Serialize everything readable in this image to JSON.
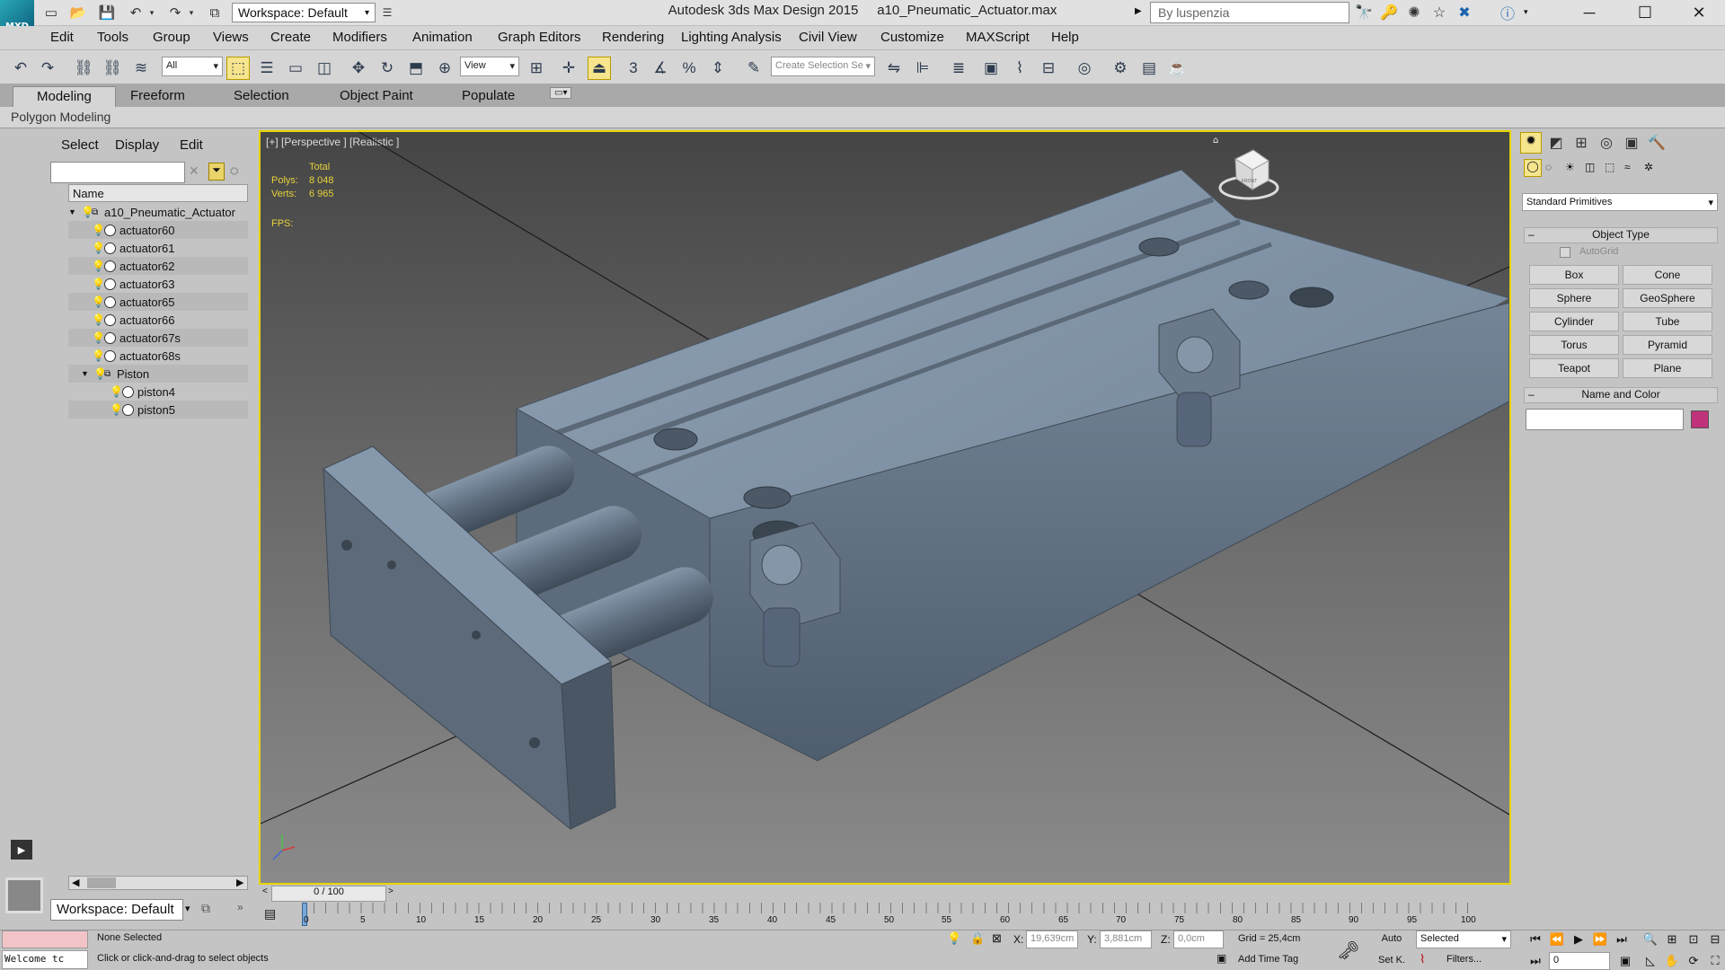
{
  "app": {
    "logo_text": "MXD",
    "title": "Autodesk 3ds Max Design 2015",
    "filename": "a10_Pneumatic_Actuator.max",
    "search_placeholder": "By luspenzia",
    "workspace": "Workspace: Default"
  },
  "menu": [
    "Edit",
    "Tools",
    "Group",
    "Views",
    "Create",
    "Modifiers",
    "Animation",
    "Graph Editors",
    "Rendering",
    "Lighting Analysis",
    "Civil View",
    "Customize",
    "MAXScript",
    "Help"
  ],
  "toolbar": {
    "filter_value": "All",
    "refcoord_value": "View",
    "selection_set_placeholder": "Create Selection Se"
  },
  "ribbon": {
    "tabs": [
      "Modeling",
      "Freeform",
      "Selection",
      "Object Paint",
      "Populate"
    ],
    "active_tab": "Modeling",
    "panel_label": "Polygon Modeling"
  },
  "explorer": {
    "menu": [
      "Select",
      "Display",
      "Edit"
    ],
    "column_header": "Name",
    "root": "a10_Pneumatic_Actuator",
    "items": [
      "actuator60",
      "actuator61",
      "actuator62",
      "actuator63",
      "actuator65",
      "actuator66",
      "actuator67s",
      "actuator68s"
    ],
    "group": "Piston",
    "group_items": [
      "piston4",
      "piston5"
    ],
    "workspace": "Workspace: Default"
  },
  "viewport": {
    "label": "[+] [Perspective ] [Realistic ]",
    "stats": {
      "header": "Total",
      "polys_label": "Polys:",
      "polys": "8 048",
      "verts_label": "Verts:",
      "verts": "6 965",
      "fps_label": "FPS:"
    },
    "viewcube_label": "FRONT"
  },
  "command_panel": {
    "category": "Standard Primitives",
    "object_type_title": "Object Type",
    "autogrid": "AutoGrid",
    "buttons": [
      "Box",
      "Cone",
      "Sphere",
      "GeoSphere",
      "Cylinder",
      "Tube",
      "Torus",
      "Pyramid",
      "Teapot",
      "Plane"
    ],
    "name_color_title": "Name and Color",
    "color": "#c0337a"
  },
  "timeline": {
    "frame": "0 / 100",
    "ticks": [
      "0",
      "5",
      "10",
      "15",
      "20",
      "25",
      "30",
      "35",
      "40",
      "45",
      "50",
      "55",
      "60",
      "65",
      "70",
      "75",
      "80",
      "85",
      "90",
      "95",
      "100"
    ]
  },
  "status": {
    "maxscript": "Welcome tc",
    "selection": "None Selected",
    "prompt": "Click or click-and-drag to select objects",
    "x_label": "X:",
    "x": "19,639cm",
    "y_label": "Y:",
    "y": "3,881cm",
    "z_label": "Z:",
    "z": "0,0cm",
    "grid": "Grid = 25,4cm",
    "add_time_tag": "Add Time Tag",
    "auto": "Auto",
    "selected": "Selected",
    "set_key": "Set K.",
    "filters": "Filters...",
    "frame_field": "0"
  }
}
